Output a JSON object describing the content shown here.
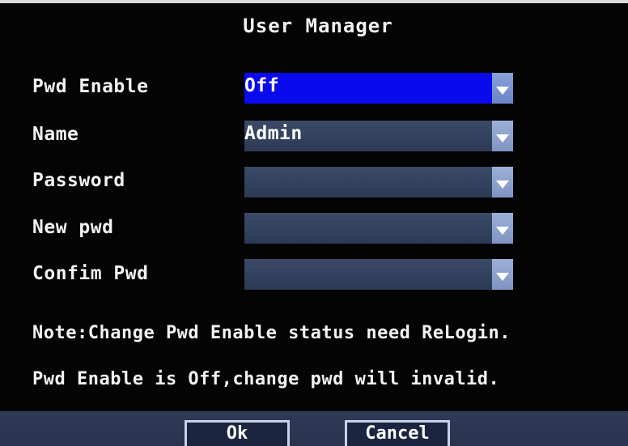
{
  "title": "User Manager",
  "fields": [
    {
      "label": "Pwd Enable",
      "value": "Off"
    },
    {
      "label": "Name",
      "value": "Admin"
    },
    {
      "label": "Password",
      "value": ""
    },
    {
      "label": "New pwd",
      "value": ""
    },
    {
      "label": "Confim Pwd",
      "value": ""
    }
  ],
  "notes": [
    "Note:Change Pwd Enable status need ReLogin.",
    "Pwd Enable is Off,change pwd will invalid."
  ],
  "buttons": {
    "ok_label": "Ok",
    "cancel_label": "Cancel"
  },
  "colors": {
    "selected_field": "#0a0aee",
    "field": "#334260",
    "background": "#040404"
  }
}
